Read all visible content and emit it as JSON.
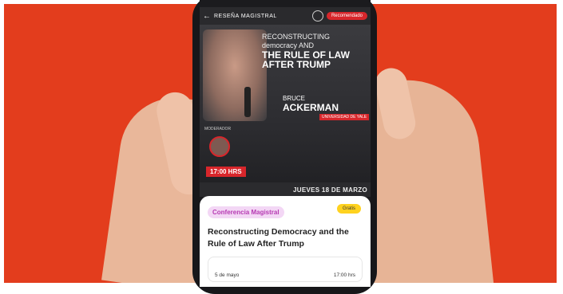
{
  "app": {
    "back_glyph": "←",
    "header_title": "RESEÑA MAGISTRAL",
    "recommend_label": "Recomendado"
  },
  "poster": {
    "title_line1": "RECONSTRUCTING",
    "title_line2": "democracy AND",
    "title_big": "THE RULE OF LAW AFTER TRUMP",
    "speaker_first": "BRUCE",
    "speaker_last": "ACKERMAN",
    "affiliation": "UNIVERSIDAD DE YALE",
    "moderation": "MODERADOR",
    "time": "17:00 HRS",
    "date_strip": "JUEVES 18 DE MARZO"
  },
  "card": {
    "chip": "Conferencia Magistral",
    "pill": "Gratis",
    "headline": "Reconstructing Democracy and the Rule of Law After Trump",
    "date": "5 de mayo",
    "hour": "17:00 hrs"
  },
  "colors": {
    "background": "#e33d1d",
    "accent": "#d8262b",
    "chip_bg": "#f3d7f5",
    "pill_bg": "#ffd21f"
  }
}
